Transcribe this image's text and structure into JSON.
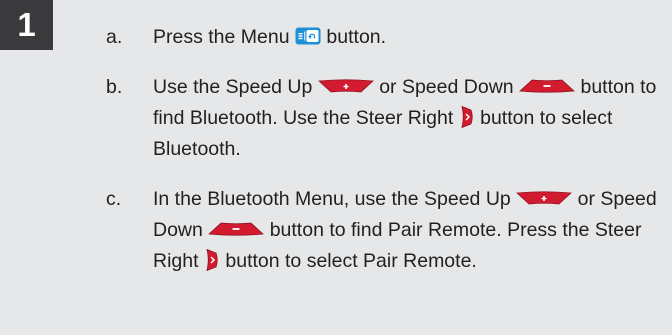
{
  "step": {
    "number": "1"
  },
  "items": [
    {
      "letter": "a.",
      "text_1": "Press the Menu",
      "text_2": "button."
    },
    {
      "letter": "b.",
      "text_1": "Use the Speed Up",
      "text_2": "or Speed Down",
      "text_3": "button to find Bluetooth. Use the Steer Right",
      "text_4": "button to select Bluetooth."
    },
    {
      "letter": "c.",
      "text_1": "In the Bluetooth Menu, use the Speed Up",
      "text_2": "or Speed Down",
      "text_3": "button to find Pair Remote. Press the Steer Right",
      "text_4": "button to select Pair Remote."
    }
  ],
  "icons": {
    "menu": "menu-button-icon",
    "speed_up": "speed-up-button-icon",
    "speed_down": "speed-down-button-icon",
    "steer_right": "steer-right-button-icon"
  },
  "colors": {
    "page_background": "#e6e7e8",
    "step_badge": "#3a3a3c",
    "text": "#231f20",
    "menu_button": "#1f8fd6",
    "remote_button": "#d21b2f"
  }
}
